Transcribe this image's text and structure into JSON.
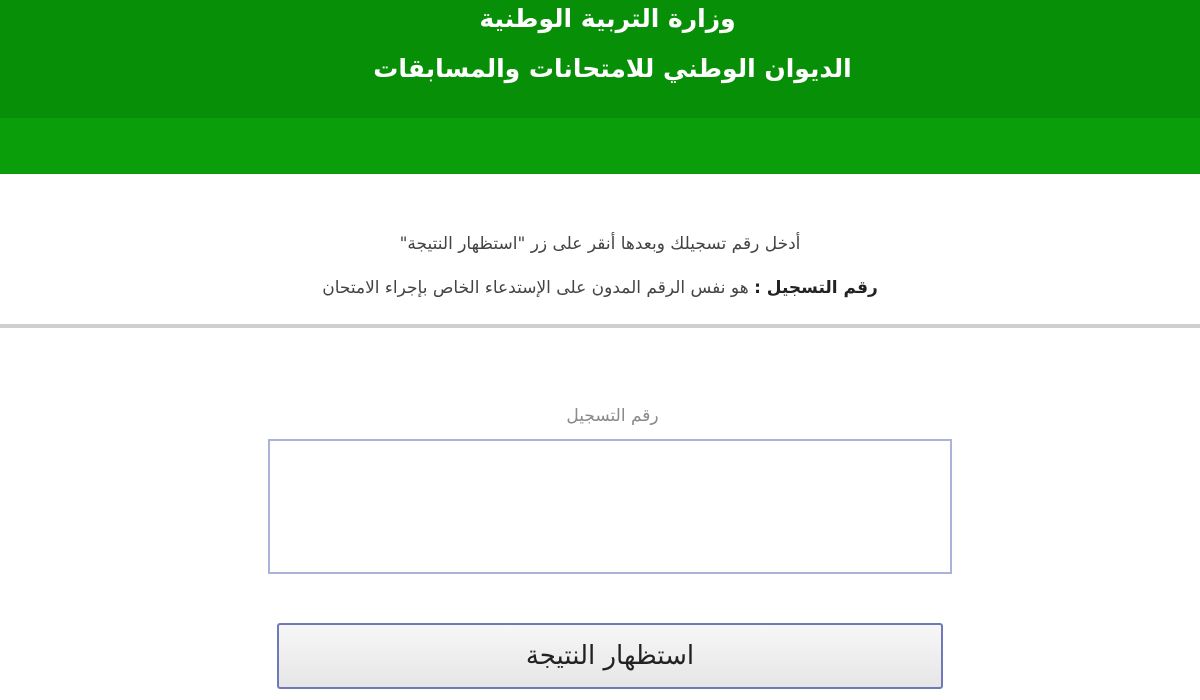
{
  "header": {
    "title": "وزارة التربية الوطنية",
    "subtitle": "الديوان الوطني للامتحانات والمسابقات"
  },
  "instructions": {
    "line1": "أدخل رقم تسجيلك وبعدها أنقر على زر \"استظهار النتيجة\"",
    "line2_bold": "رقم التسجيل :",
    "line2_rest": " هو نفس الرقم المدون على الإستدعاء الخاص بإجراء الامتحان"
  },
  "form": {
    "label": "رقم التسجيل",
    "input_value": "",
    "button_label": "استظهار النتيجة"
  },
  "colors": {
    "header_dark": "#078f07",
    "header_band": "#0a9f0a",
    "divider": "#cfcfcf"
  }
}
